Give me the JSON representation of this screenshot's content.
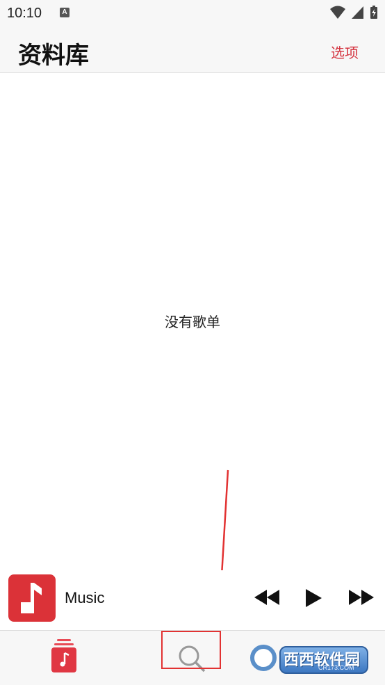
{
  "status_bar": {
    "time": "10:10",
    "notification_icon": "A"
  },
  "header": {
    "title": "资料库",
    "options_label": "选项"
  },
  "main": {
    "empty_message": "没有歌单"
  },
  "mini_player": {
    "track_title": "Music",
    "controls": [
      "rewind-icon",
      "play-icon",
      "fast-forward-icon"
    ]
  },
  "tab_bar": {
    "tabs": [
      "library-icon",
      "search-icon"
    ]
  },
  "watermark": {
    "brand": "西西软件园",
    "domain": "CR173.COM"
  },
  "colors": {
    "accent": "#d4323e",
    "highlight": "#e23232",
    "album_bg": "#db3238"
  }
}
